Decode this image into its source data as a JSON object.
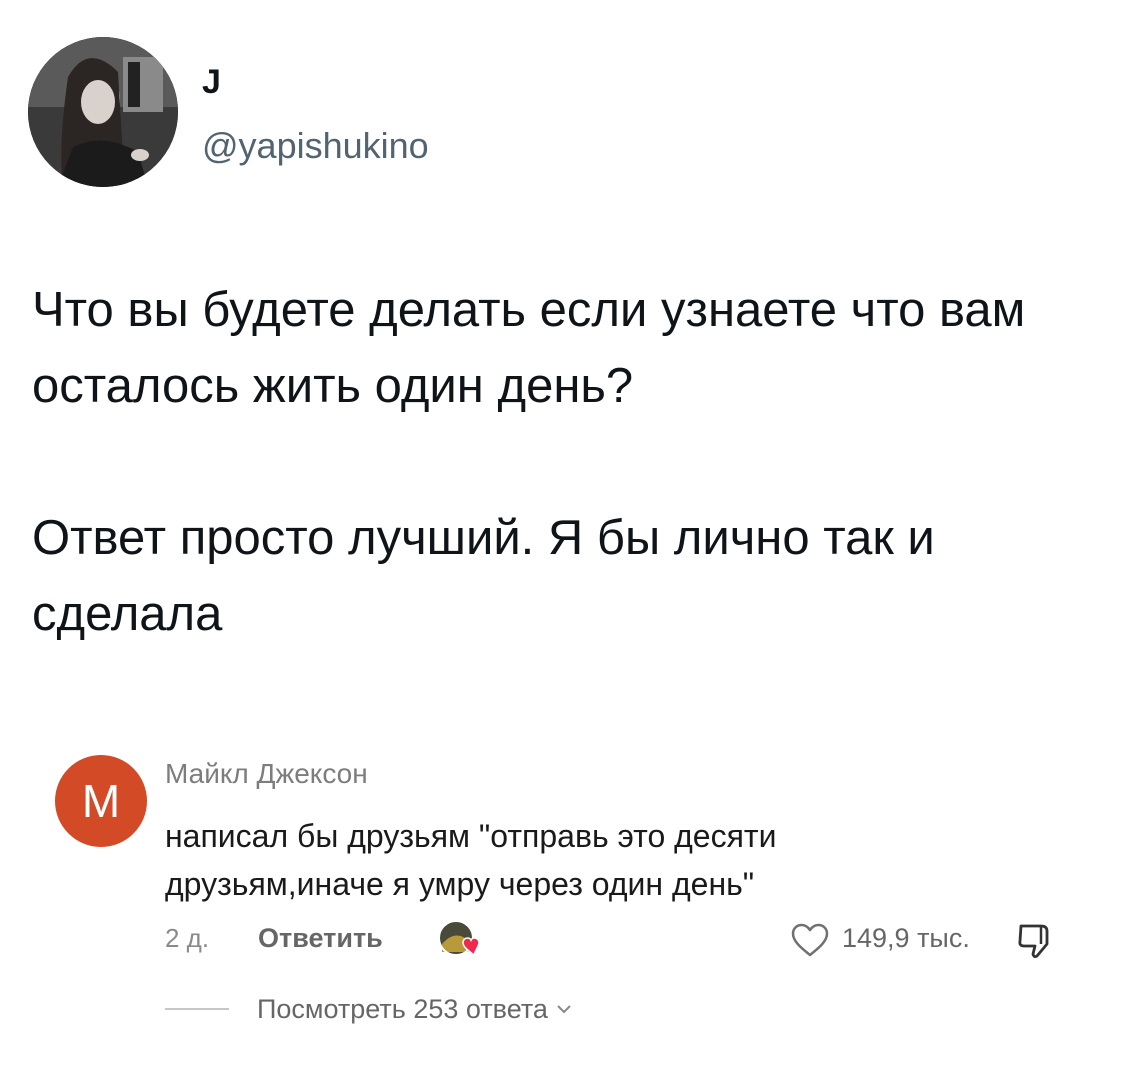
{
  "tweet": {
    "display_name": "J",
    "handle": "@yapishukino",
    "paragraphs": [
      "Что вы будете делать если узнаете что вам осталось жить один день?",
      "Ответ просто лучший. Я бы лично так и сделала"
    ],
    "avatar_icon": "profile-photo-avatar"
  },
  "comment": {
    "avatar_letter": "M",
    "avatar_color": "#d24a26",
    "author": "Майкл Джексон",
    "text": "написал бы друзьям \"отправь это десяти друзьям,иначе я умру через один день\"",
    "time_ago": "2 д.",
    "reply_label": "Ответить",
    "creator_like_icon": "creator-heart-avatar-icon",
    "like_icon": "heart-outline-icon",
    "like_count": "149,9 тыс.",
    "dislike_icon": "thumbs-down-icon",
    "view_replies_label": "Посмотреть 253 ответа",
    "view_replies_icon": "chevron-down-icon"
  }
}
